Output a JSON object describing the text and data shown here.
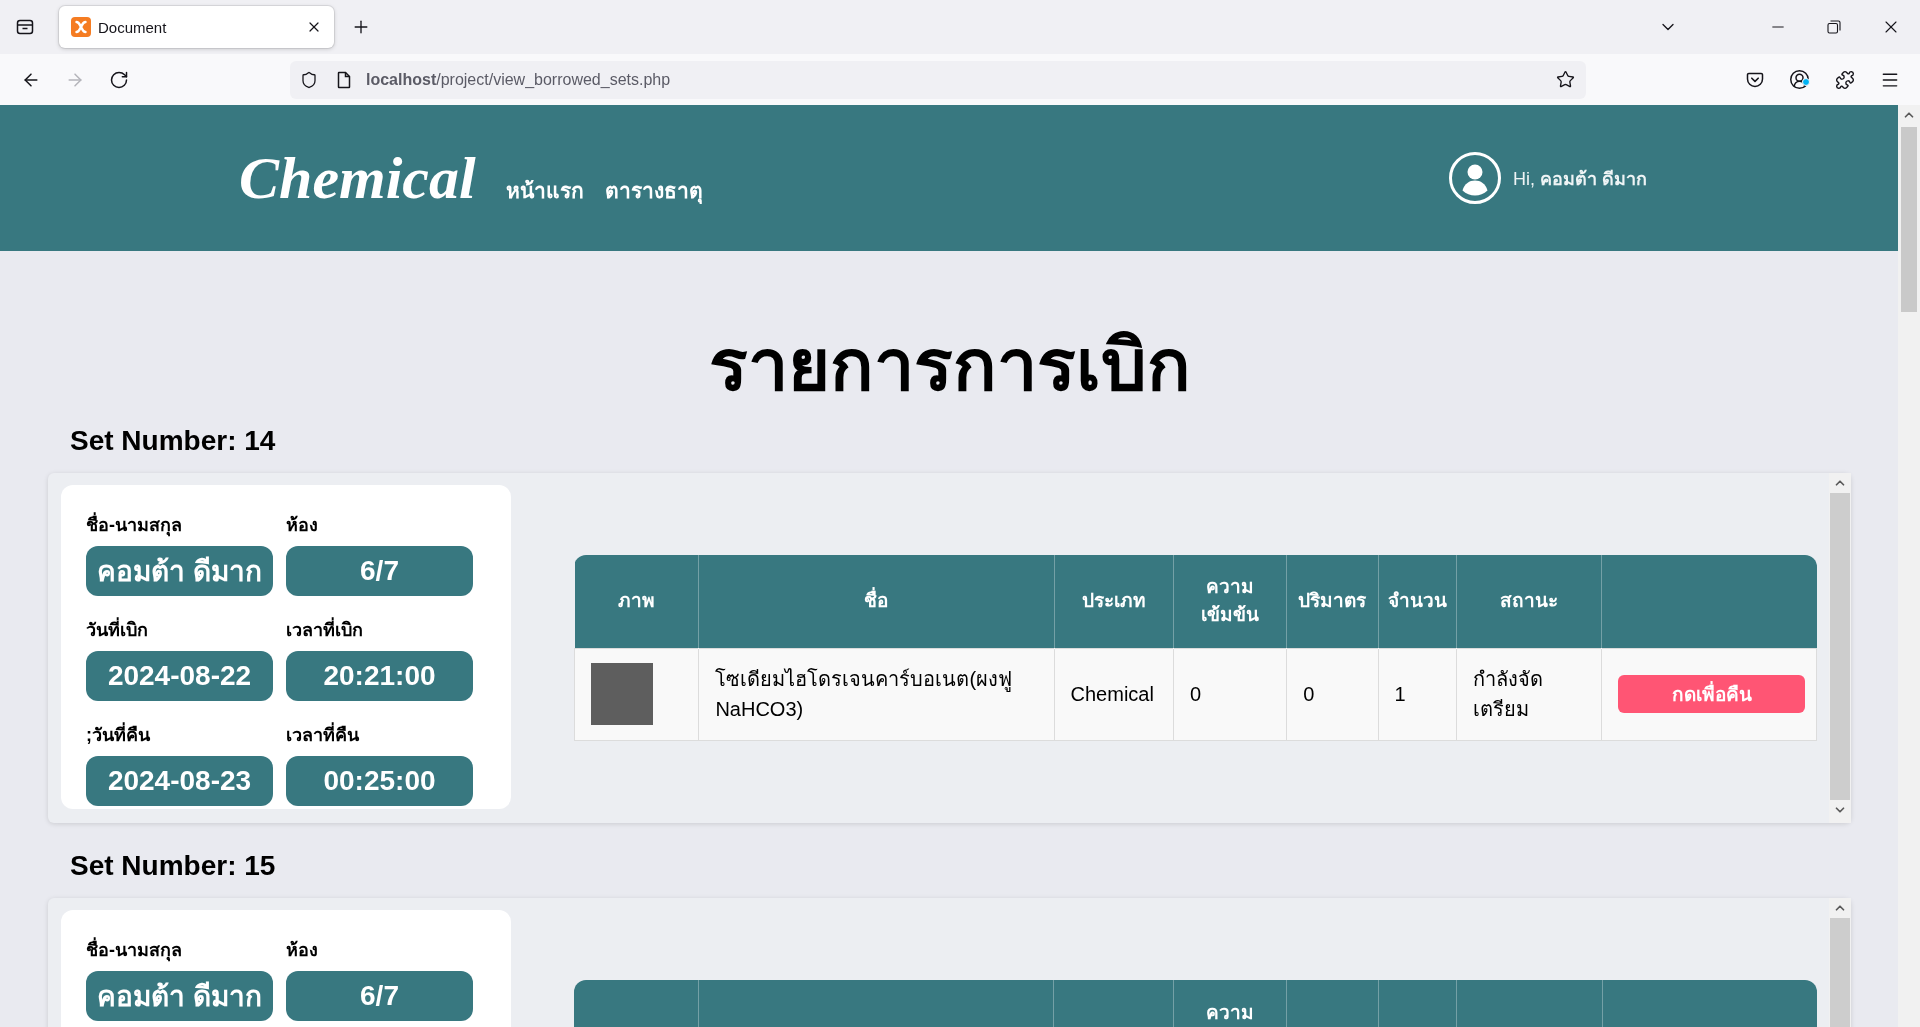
{
  "browser": {
    "tab": {
      "title": "Document",
      "selected": true
    },
    "nav_buttons": [
      {
        "kind": "back",
        "disabled": false
      },
      {
        "kind": "forward",
        "disabled": true
      },
      {
        "kind": "reload",
        "disabled": false
      }
    ],
    "address": "**localhost**/project/view_borrowed_sets.php",
    "account_notification": true
  },
  "site": {
    "logo": "Chemical",
    "nav": [
      {
        "label": "หน้าแรก"
      },
      {
        "label": "ตารางธาตุ"
      }
    ],
    "greeting": "Hi, **คอมต้า ดีมาก**"
  },
  "page_title": "รายการการเบิก",
  "sets": [
    {
      "heading": "Set Number: 14",
      "fields": [
        {
          "label": "ชื่อ-นามสกุล",
          "value": "คอมต้า ดีมาก"
        },
        {
          "label": "ห้อง",
          "value": "6/7"
        },
        {
          "label": "วันที่เบิก",
          "value": "2024-08-22"
        },
        {
          "label": "เวลาที่เบิก",
          "value": "20:21:00"
        },
        {
          "label": ";วันที่คืน",
          "value": "2024-08-23"
        },
        {
          "label": "เวลาที่คืน",
          "value": "00:25:00"
        }
      ],
      "table": {
        "columns": [
          {
            "label": "ภาพ"
          },
          {
            "label": "ชื่อ"
          },
          {
            "label": "ประเภท"
          },
          {
            "label": "ความ\nเข้มข้น"
          },
          {
            "label": "ปริมาตร"
          },
          {
            "label": "จำนวน"
          },
          {
            "label": "สถานะ"
          },
          {}
        ],
        "rows": [
          {
            "name": "โซเดียมไฮโดรเจนคาร์บอเนต(ผงฟู NaHCO3)",
            "type": "Chemical",
            "concentration": "0",
            "volume": "0",
            "quantity": "1",
            "status": "กำลังจัดเตรียม",
            "action": "กดเพื่อคืน"
          }
        ]
      }
    },
    {
      "heading": "Set Number: 15",
      "fields": [
        {
          "label": "ชื่อ-นามสกุล",
          "value": "คอมต้า ดีมาก"
        },
        {
          "label": "ห้อง",
          "value": "6/7"
        }
      ],
      "table": {
        "columns": [
          {},
          {},
          {},
          {
            "label": "ความ",
            "continues": true
          },
          {},
          {},
          {},
          {}
        ]
      }
    }
  ]
}
